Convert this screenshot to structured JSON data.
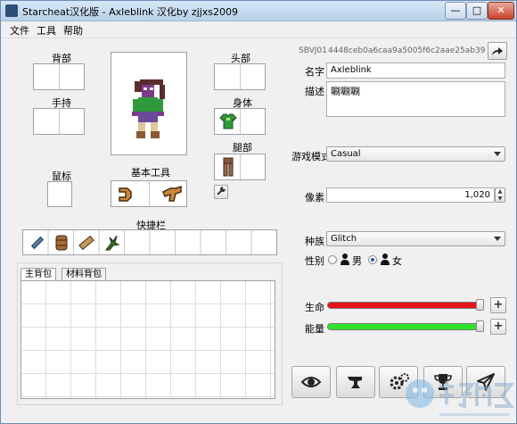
{
  "window": {
    "title": "Starcheat汉化版 - Axleblink        汉化by zjjxs2009",
    "btn_minimize": "—",
    "btn_maximize": "□",
    "btn_close": "✕"
  },
  "menu": [
    "文件",
    "工具",
    "帮助"
  ],
  "equipment": {
    "back_label": "背部",
    "hand_label": "手持",
    "head_label": "头部",
    "body_label": "身体",
    "legs_label": "腿部",
    "cursor_label": "鼠标",
    "basic_tools_label": "基本工具",
    "hotbar_label": "快捷栏"
  },
  "inventory": {
    "tab_main": "主背包",
    "tab_materials": "材料背包"
  },
  "character": {
    "id_prefix": "SBVJ01",
    "uuid": "4448ceb0a6caa9a5005f6c2aae25ab39",
    "name_label": "名字",
    "name_value": "Axleblink",
    "desc_label": "描述",
    "desc_value": "唰唰唰",
    "mode_label": "游戏模式",
    "mode_value": "Casual",
    "pixels_label": "像素",
    "pixels_value": "1,020",
    "race_label": "种族",
    "race_value": "Glitch",
    "gender_label": "性别",
    "gender_male": "男",
    "gender_female": "女",
    "gender_selected": "女"
  },
  "stats": {
    "health_label": "生命",
    "energy_label": "能量",
    "health_fill": 1.0,
    "energy_fill": 1.0,
    "health_color": "#e8141b",
    "energy_color": "#2ee52a"
  },
  "icons": {
    "export": "share-arrow-icon",
    "wrench": "wrench-icon",
    "eye": "eye-icon",
    "anvil": "anvil-icon",
    "gears": "gears-icon",
    "trophy": "trophy-icon",
    "send": "paper-plane-icon"
  }
}
